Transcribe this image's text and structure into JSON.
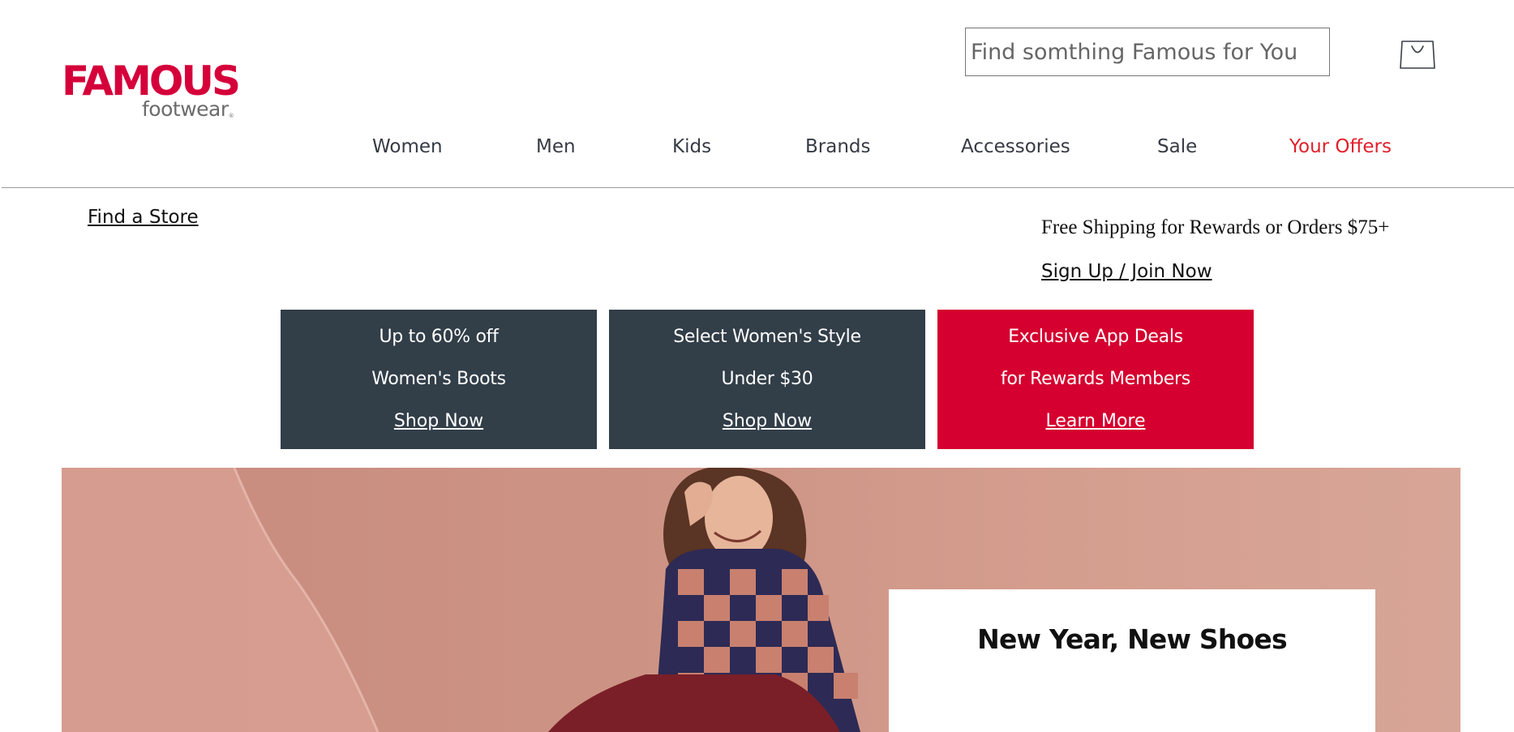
{
  "brand": {
    "name_main": "FAMOUS",
    "name_sub": "footwear",
    "trademark": "®"
  },
  "search": {
    "placeholder": "Find somthing Famous for You",
    "value": ""
  },
  "nav": {
    "items": [
      {
        "label": "Women"
      },
      {
        "label": "Men"
      },
      {
        "label": "Kids"
      },
      {
        "label": "Brands"
      },
      {
        "label": "Accessories"
      },
      {
        "label": "Sale"
      },
      {
        "label": "Your Offers"
      }
    ]
  },
  "utility": {
    "find_store": "Find a Store",
    "free_shipping": "Free Shipping for Rewards or Orders $75+",
    "signup": "Sign Up / Join Now"
  },
  "promos": [
    {
      "line1": "Up to 60% off",
      "line2": "Women's Boots",
      "cta": "Shop Now"
    },
    {
      "line1": "Select Women's Style",
      "line2": "Under $30",
      "cta": "Shop Now"
    },
    {
      "line1": "Exclusive App Deals",
      "line2": "for Rewards Members",
      "cta": "Learn More"
    }
  ],
  "hero": {
    "title": "New Year, New Shoes"
  },
  "colors": {
    "brand_red": "#d5003a",
    "offers_red": "#e1202c",
    "promo_dark": "#323e48",
    "promo_red": "#d5002f",
    "hero_pink": "#cd9485"
  },
  "icons": {
    "cart": "shopping-bag-icon",
    "logo": "famous-footwear-logo"
  }
}
